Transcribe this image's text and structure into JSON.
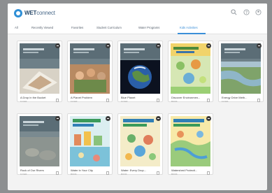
{
  "app": {
    "brand_bold": "WET",
    "brand_light": "connect"
  },
  "header": {
    "icons": [
      "search-icon",
      "help-icon",
      "account-icon"
    ]
  },
  "tabs": [
    {
      "label": "All",
      "active": false
    },
    {
      "label": "Recently Viewed",
      "active": false
    },
    {
      "label": "Favorites",
      "active": false
    },
    {
      "label": "Student Curriculum",
      "active": false
    },
    {
      "label": "Water Programs",
      "active": false
    },
    {
      "label": "Kids Activities",
      "active": true
    }
  ],
  "cards": [
    {
      "title": "A Drop in the Bucket",
      "meta": "FLYER",
      "theme": "photo-paper"
    },
    {
      "title": "A Planet Problem",
      "meta": "FLYER",
      "theme": "photo-people"
    },
    {
      "title": "Blue Planet",
      "meta": "FLYER",
      "theme": "earth"
    },
    {
      "title": "Discover Environmen...",
      "meta": "BOOK",
      "theme": "illustrated-green"
    },
    {
      "title": "Energy Drive Meth...",
      "meta": "FLYER",
      "theme": "photo-river"
    },
    {
      "title": "Rock of Our Rivers",
      "meta": "FLYER",
      "theme": "photo-gray"
    },
    {
      "title": "Water in Your City",
      "meta": "BOOK",
      "theme": "illustrated-city"
    },
    {
      "title": "Water: Every Drop...",
      "meta": "BOOK",
      "theme": "illustrated-drop"
    },
    {
      "title": "Watershed Protecti...",
      "meta": "BOOK",
      "theme": "illustrated-watershed"
    }
  ]
}
